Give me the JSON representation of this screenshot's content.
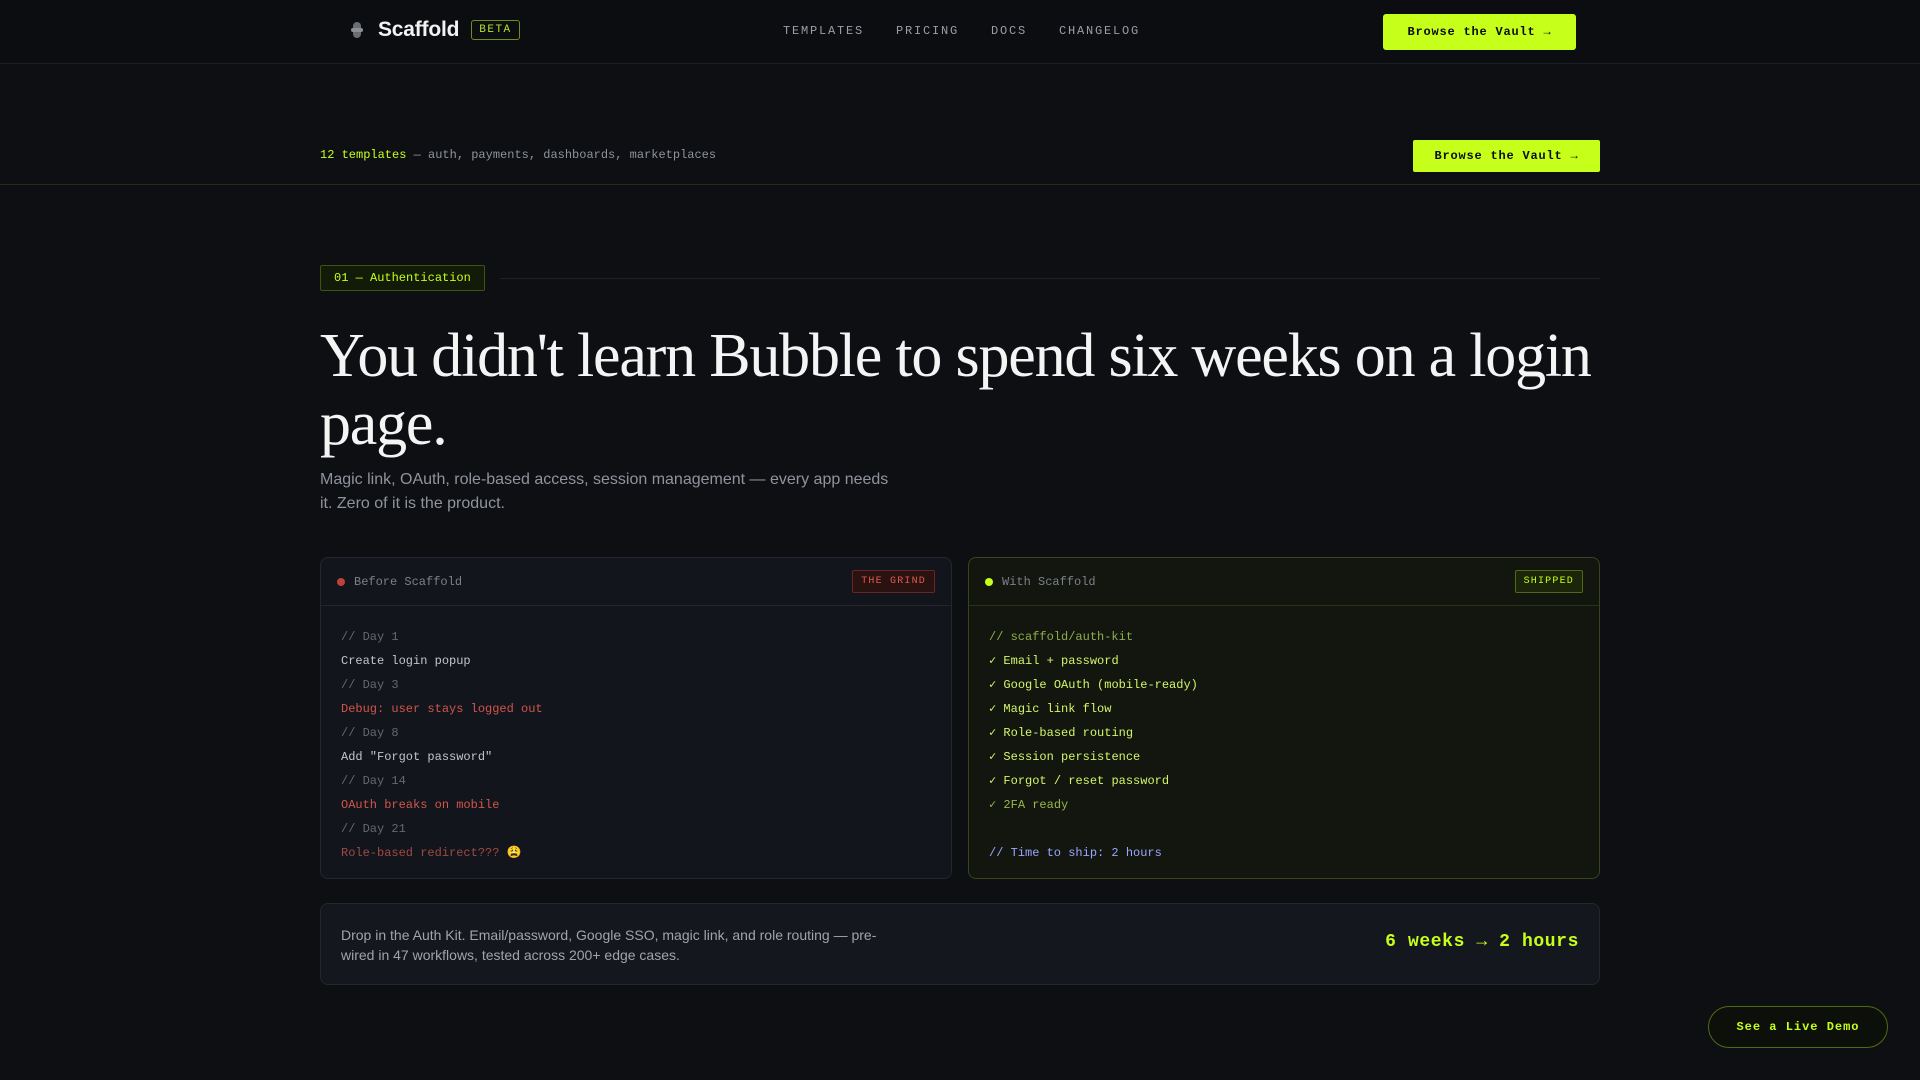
{
  "nav": {
    "brand": "Scaffold",
    "beta": "BETA",
    "links": [
      "TEMPLATES",
      "PRICING",
      "DOCS",
      "CHANGELOG"
    ],
    "cta": "Browse the Vault",
    "cta_arrow": "→"
  },
  "subbar": {
    "count": "12 templates",
    "description": " — auth, payments, dashboards, marketplaces",
    "cta": "Browse the Vault →"
  },
  "section": {
    "tag": "01 — Authentication",
    "headline": "You didn't learn Bubble to spend six weeks on a login page.",
    "subhead": "Magic link, OAuth, role-based access, session management — every app needs it. Zero of it is the product."
  },
  "before": {
    "title": "Before Scaffold",
    "badge": "THE GRIND",
    "lines": [
      "// Day 1",
      "Create login popup",
      "// Day 3",
      "Debug: user stays logged out",
      "// Day 8",
      "Add \"Forgot password\"",
      "// Day 14",
      "OAuth breaks on mobile",
      "// Day 21",
      "Role-based redirect??? 😩"
    ]
  },
  "after": {
    "title": "With Scaffold",
    "badge": "SHIPPED",
    "lines": [
      "// scaffold/auth-kit",
      "✓ Email + password",
      "✓ Google OAuth (mobile-ready)",
      "✓ Magic link flow",
      "✓ Role-based routing",
      "✓ Session persistence",
      "✓ Forgot / reset password",
      "✓ 2FA ready",
      "// Time to ship: 2 hours"
    ]
  },
  "result": {
    "text": "Drop in the Auth Kit. Email/password, Google SSO, magic link, and role routing — pre-wired in 47 workflows, tested across 200+ edge cases.",
    "metric": "6 weeks → 2 hours"
  },
  "demo": {
    "label": "See a Live Demo"
  },
  "colors": {
    "accent": "#c6ff1a",
    "background": "#0d0f13",
    "error": "#d2554c"
  },
  "icons": {
    "brand": "scaffold-logo-icon",
    "arrow": "arrow-right-icon"
  }
}
